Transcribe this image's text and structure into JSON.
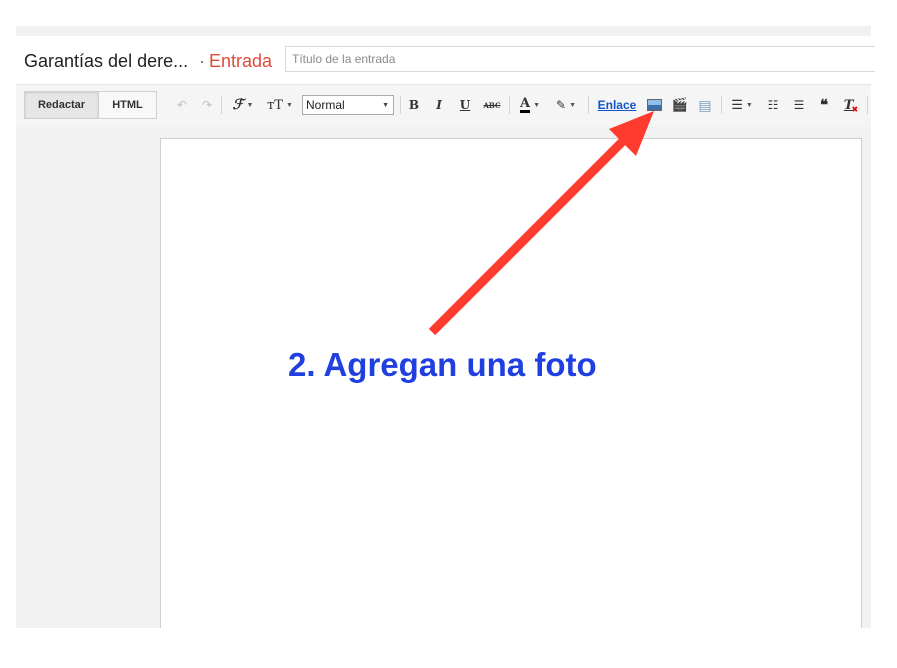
{
  "header": {
    "blog_name": "Garantías del dere...",
    "separator": "·",
    "kind_label": "Entrada",
    "title_placeholder": "Título de la entrada"
  },
  "toolbar": {
    "compose_label": "Redactar",
    "html_label": "HTML",
    "font_size_glyph": "тT",
    "format_value": "Normal",
    "bold_glyph": "B",
    "italic_glyph": "I",
    "underline_glyph": "U",
    "strike_glyph": "ABC",
    "text_color_glyph": "A",
    "link_label": "Enlace",
    "quote_glyph": "❝",
    "clear_format_glyph": "T"
  },
  "annotation": {
    "text": "2. Agregan una foto"
  },
  "colors": {
    "kind_label": "#dd4b39",
    "link": "#1155cc",
    "annotation_text": "#1f3fe0",
    "annotation_arrow": "#ff3b30"
  },
  "icons": [
    "undo-icon",
    "redo-icon",
    "font-family-icon",
    "font-size-icon",
    "text-color-icon",
    "highlight-icon",
    "insert-image-icon",
    "insert-video-icon",
    "jump-break-icon",
    "align-icon",
    "numbered-list-icon",
    "bullet-list-icon",
    "quote-icon",
    "clear-format-icon"
  ]
}
